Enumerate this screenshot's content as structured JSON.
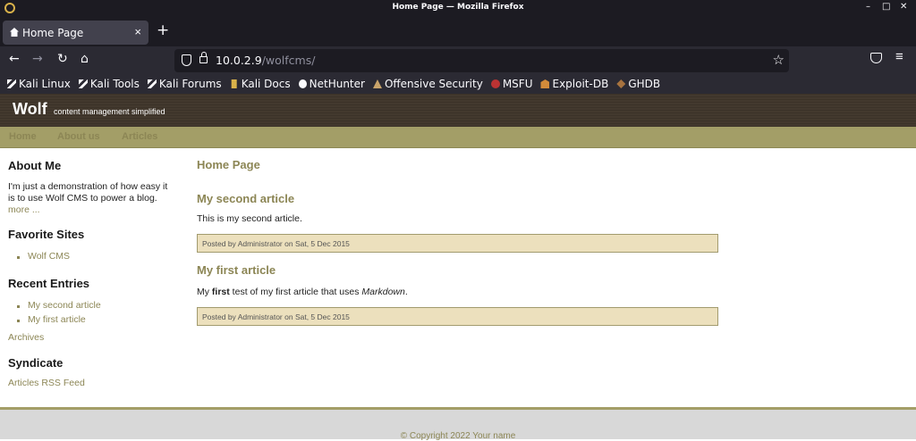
{
  "window": {
    "title": "Home Page — Mozilla Firefox"
  },
  "tab": {
    "label": "Home Page",
    "close": "×"
  },
  "newtab": "+",
  "nav": {
    "back": "←",
    "forward": "→",
    "reload": "↻",
    "home": "⌂"
  },
  "urlbar": {
    "host": "10.0.2.9",
    "path": "/wolfcms/",
    "star": "☆"
  },
  "menu_icon": "≡",
  "bookmarks": [
    {
      "label": "Kali Linux",
      "icon": "kali-dragon-icon"
    },
    {
      "label": "Kali Tools",
      "icon": "kali-dragon-icon"
    },
    {
      "label": "Kali Forums",
      "icon": "kali-dragon-icon"
    },
    {
      "label": "Kali Docs",
      "icon": "doc-icon"
    },
    {
      "label": "NetHunter",
      "icon": "nethunter-icon"
    },
    {
      "label": "Offensive Security",
      "icon": "offsec-icon"
    },
    {
      "label": "MSFU",
      "icon": "msfu-icon"
    },
    {
      "label": "Exploit-DB",
      "icon": "exploitdb-icon"
    },
    {
      "label": "GHDB",
      "icon": "ghdb-icon"
    }
  ],
  "site": {
    "name": "Wolf",
    "slogan": "content management simplified",
    "nav": [
      "Home",
      "About us",
      "Articles"
    ]
  },
  "sidebar": {
    "about_title": "About Me",
    "about_text": "I'm just a demonstration of how easy it is to use Wolf CMS to power a blog.",
    "about_more": "more ...",
    "favorites_title": "Favorite Sites",
    "favorites": [
      "Wolf CMS"
    ],
    "recent_title": "Recent Entries",
    "recent": [
      "My second article",
      "My first article"
    ],
    "archives": "Archives",
    "syndicate_title": "Syndicate",
    "rss": "Articles RSS Feed"
  },
  "content": {
    "page_title": "Home Page",
    "articles": [
      {
        "title": "My second article",
        "body": "This is my second article.",
        "info": "Posted by Administrator on Sat, 5 Dec 2015"
      },
      {
        "title": "My first article",
        "body_pre": "My ",
        "body_bold": "first",
        "body_mid": " test of my first article that uses ",
        "body_em": "Markdown",
        "body_post": ".",
        "info": "Posted by Administrator on Sat, 5 Dec 2015"
      }
    ]
  },
  "footer": {
    "copyright": "© Copyright 2022 Your name"
  }
}
